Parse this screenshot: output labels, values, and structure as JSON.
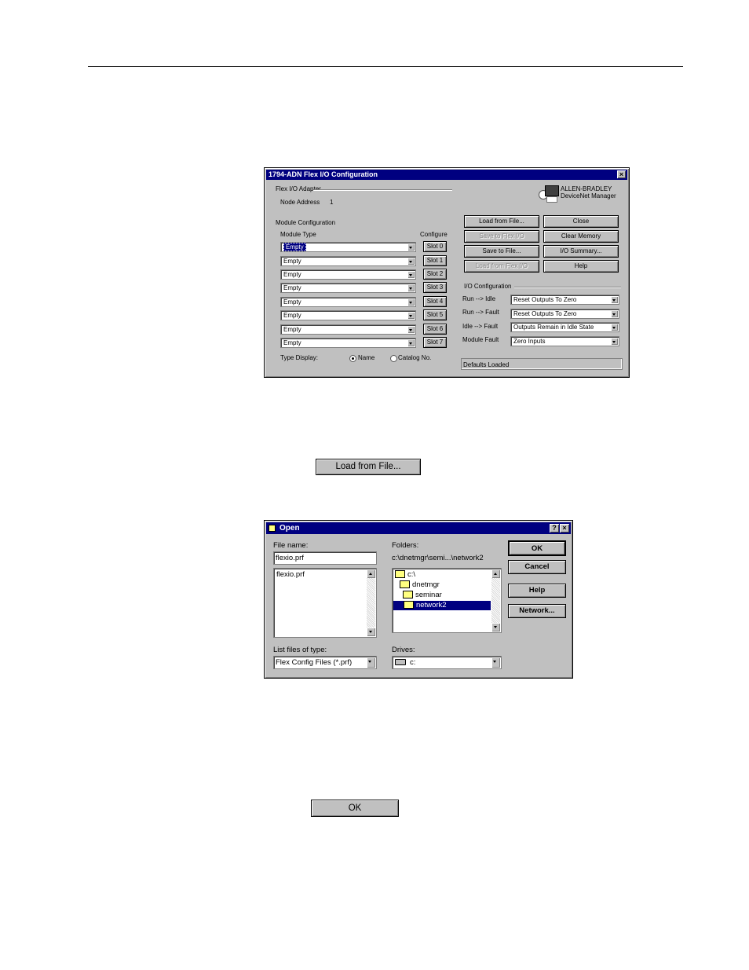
{
  "flex_dialog": {
    "title": "1794-ADN Flex I/O Configuration",
    "close_glyph": "×",
    "adapter_group": "Flex I/O Adapter",
    "node_address_label": "Node Address",
    "node_address_value": "1",
    "brand_line1": "ALLEN-BRADLEY",
    "brand_line2": "DeviceNet Manager",
    "module_config_group": "Module Configuration",
    "module_type_header": "Module Type",
    "configure_header": "Configure",
    "slots": [
      {
        "value": "Empty",
        "button": "Slot 0"
      },
      {
        "value": "Empty",
        "button": "Slot 1"
      },
      {
        "value": "Empty",
        "button": "Slot 2"
      },
      {
        "value": "Empty",
        "button": "Slot 3"
      },
      {
        "value": "Empty",
        "button": "Slot 4"
      },
      {
        "value": "Empty",
        "button": "Slot 5"
      },
      {
        "value": "Empty",
        "button": "Slot 6"
      },
      {
        "value": "Empty",
        "button": "Slot 7"
      }
    ],
    "type_display_label": "Type Display:",
    "radio_name": "Name",
    "radio_catalog": "Catalog No.",
    "buttons": {
      "load_from_file": "Load from File...",
      "close": "Close",
      "save_to_flex_io": "Save to Flex I/O",
      "clear_memory": "Clear Memory",
      "save_to_file": "Save to File...",
      "io_summary": "I/O Summary...",
      "load_from_flex_io": "Load from Flex I/O",
      "help": "Help"
    },
    "io_config_group": "I/O Configuration",
    "io_rows": [
      {
        "label": "Run --> Idle",
        "value": "Reset Outputs To Zero"
      },
      {
        "label": "Run --> Fault",
        "value": "Reset Outputs To Zero"
      },
      {
        "label": "Idle --> Fault",
        "value": "Outputs Remain in Idle State"
      },
      {
        "label": "Module Fault",
        "value": "Zero Inputs"
      }
    ],
    "status": "Defaults Loaded"
  },
  "load_button_label": "Load from File...",
  "open_dialog": {
    "title": "Open",
    "help_glyph": "?",
    "close_glyph": "×",
    "file_name_label": "File name:",
    "file_name_value": "flexio.prf",
    "files": [
      "flexio.prf"
    ],
    "folders_label": "Folders:",
    "folder_path": "c:\\dnetmgr\\semi...\\network2",
    "folder_tree": [
      "c:\\",
      "dnetmgr",
      "seminar",
      "network2"
    ],
    "list_type_label": "List files of type:",
    "list_type_value": "Flex Config Files (*.prf)",
    "drives_label": "Drives:",
    "drives_value": "c:",
    "buttons": {
      "ok": "OK",
      "cancel": "Cancel",
      "help": "Help",
      "network": "Network..."
    }
  },
  "ok_button_label": "OK"
}
